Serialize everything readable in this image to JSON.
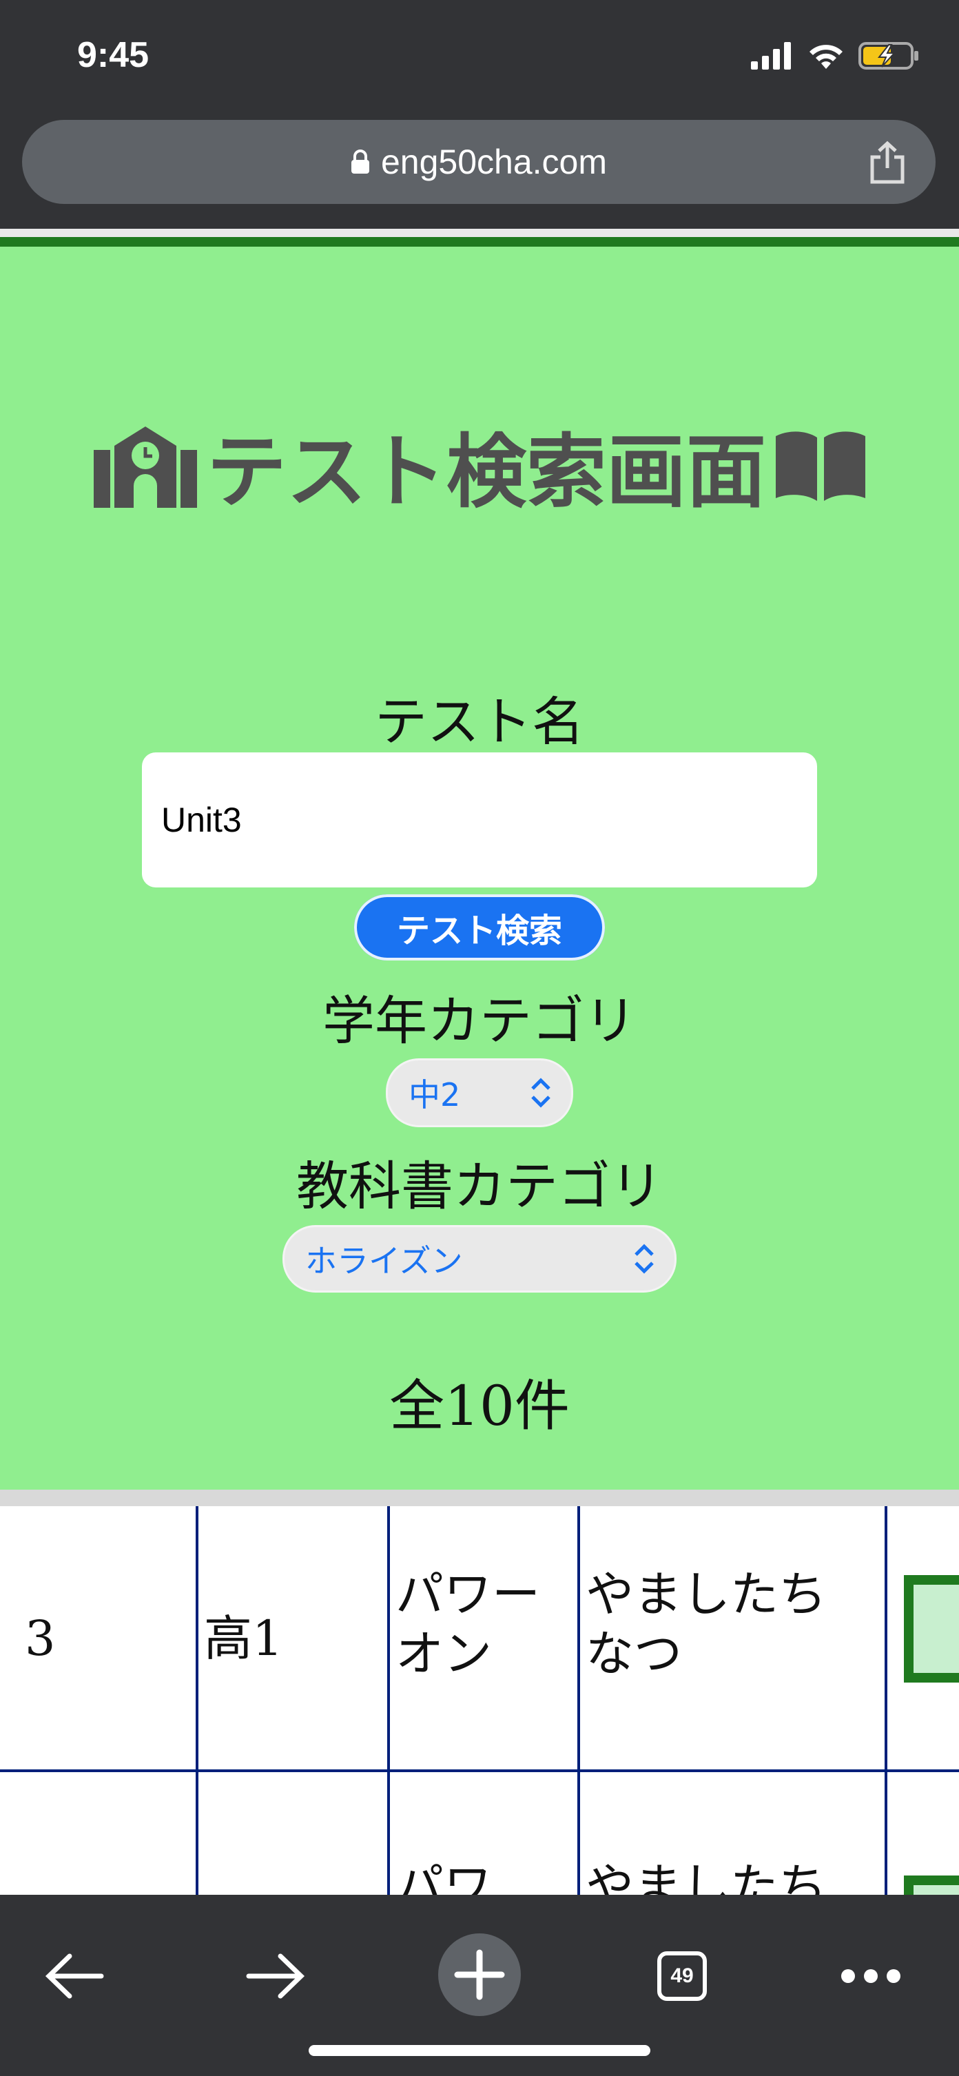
{
  "status": {
    "time": "9:45"
  },
  "browser": {
    "url": "eng50cha.com",
    "tab_count": "49"
  },
  "page": {
    "title": "テスト検索画面",
    "test_name_label": "テスト名",
    "test_name_value": "Unit3",
    "search_button": "テスト検索",
    "grade_label": "学年カテゴリ",
    "grade_selected": "中2",
    "textbook_label": "教科書カテゴリ",
    "textbook_selected": "ホライズン",
    "result_count": "全10件"
  },
  "table": {
    "rows": [
      {
        "no": "3",
        "grade": "高1",
        "textbook_line1": "パワー",
        "textbook_line2": "オン",
        "author_line1": "やましたち",
        "author_line2": "なつ"
      },
      {
        "textbook_partial": "パワ",
        "author_partial": "やましたち"
      }
    ]
  },
  "colors": {
    "page_bg": "#90ee8f",
    "accent_blue": "#1a73f2",
    "dark_green": "#1f7a1f",
    "table_border": "#001f7a",
    "browser_chrome": "#323336"
  }
}
